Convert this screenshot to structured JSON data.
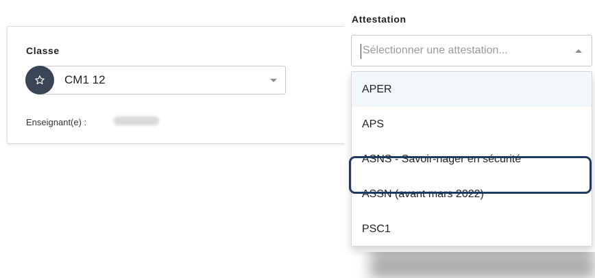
{
  "classe": {
    "label": "Classe",
    "selected_value": "CM1 12",
    "icon": "star-icon",
    "teacher_label": "Enseignant(e) :"
  },
  "attestation": {
    "label": "Attestation",
    "placeholder": "Sélectionner une attestation...",
    "options": [
      {
        "label": "APER"
      },
      {
        "label": "APS"
      },
      {
        "label": "ASNS - Savoir-nager en sécurité"
      },
      {
        "label": "ASSN (avant mars 2022)"
      },
      {
        "label": "PSC1"
      }
    ],
    "hovered_option": "APER",
    "highlighted_option": "ASNS - Savoir-nager en sécurité"
  },
  "colors": {
    "badge": "#3a4655",
    "highlight_border": "#1f3a5f",
    "hover_bg": "#f2f7fb"
  }
}
